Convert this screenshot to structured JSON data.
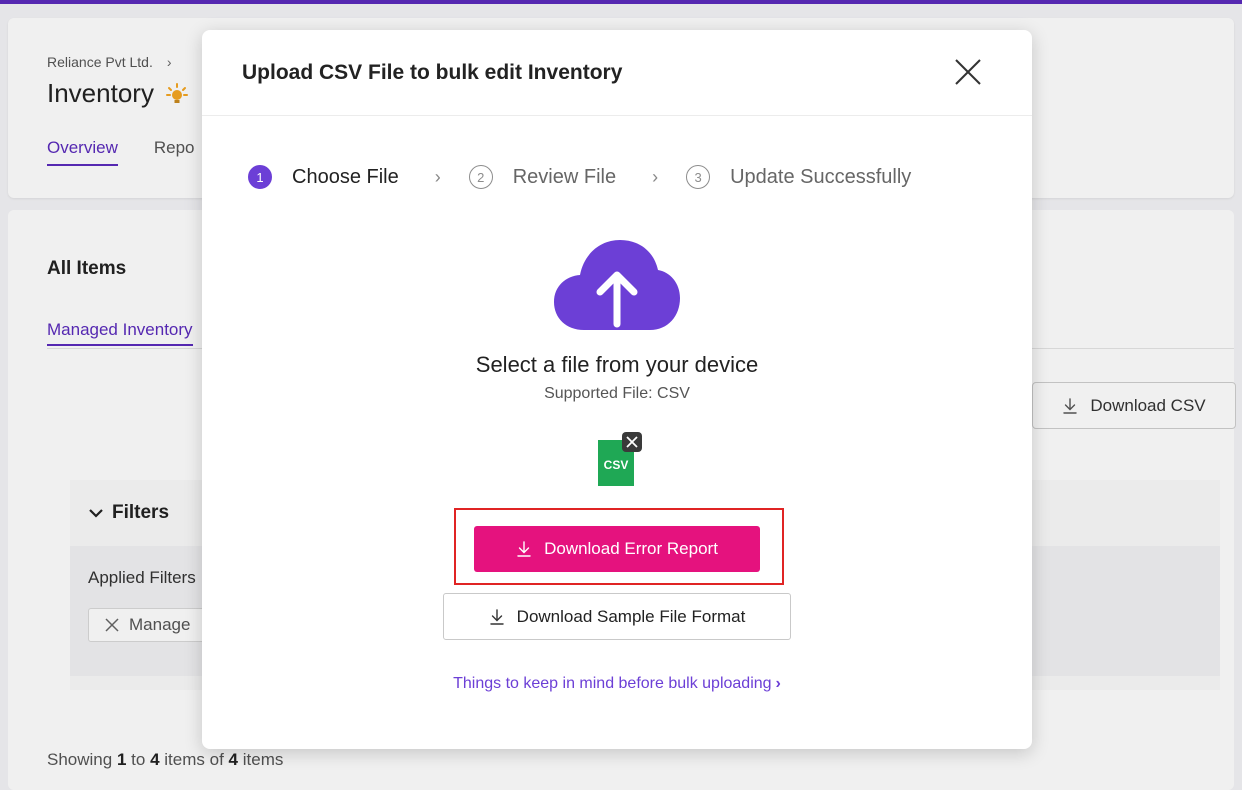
{
  "background": {
    "breadcrumb": "Reliance Pvt Ltd.",
    "page_title": "Inventory",
    "tabs": [
      "Overview",
      "Repo"
    ],
    "section_title": "All Items",
    "managed_tab": "Managed Inventory",
    "download_csv": "Download CSV",
    "filters_title": "Filters",
    "applied_filters_label": "Applied Filters",
    "chip_label": "Manage",
    "showing": {
      "prefix": "Showing",
      "from": "1",
      "to_word": "to",
      "to": "4",
      "of_word": "items of",
      "total": "4",
      "suffix": "items"
    }
  },
  "modal": {
    "title": "Upload CSV File to bulk edit Inventory",
    "steps": [
      {
        "num": "1",
        "label": "Choose File"
      },
      {
        "num": "2",
        "label": "Review File"
      },
      {
        "num": "3",
        "label": "Update Successfully"
      }
    ],
    "select_text": "Select a file from your device",
    "supported_text": "Supported File: CSV",
    "file_badge": "CSV",
    "error_button": "Download Error Report",
    "sample_button": "Download Sample File Format",
    "keep_in_mind_link": "Things to keep in mind before bulk uploading"
  },
  "colors": {
    "accent": "#6c3fd6",
    "error_button": "#e5127e",
    "highlight": "#e02424",
    "csv_green": "#1fa855"
  }
}
